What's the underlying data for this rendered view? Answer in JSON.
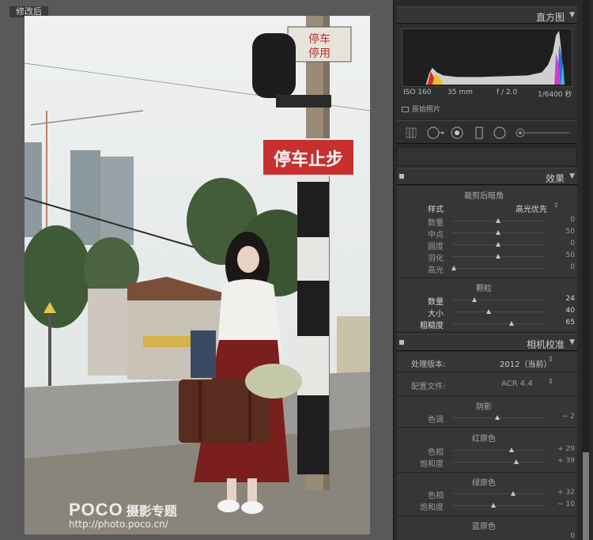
{
  "view": {
    "mode_label": "修改后",
    "watermark_brand": "POCO",
    "watermark_title": "摄影专题",
    "watermark_url": "http://photo.poco.cn/",
    "sign_text": "停车止步",
    "sign_top_line1": "停车",
    "sign_top_line2": "停用"
  },
  "histogram": {
    "title": "直方图",
    "iso": "ISO 160",
    "focal": "35 mm",
    "aperture": "f / 2.0",
    "shutter": "1/6400 秒",
    "original_label": "原始照片"
  },
  "effects": {
    "title": "效果",
    "vignette_heading": "裁剪后暗角",
    "style_label": "样式",
    "style_value": "高光优先",
    "sliders": [
      {
        "label": "数量",
        "value": "0",
        "pos": 0.5
      },
      {
        "label": "中点",
        "value": "50",
        "pos": 0.5
      },
      {
        "label": "圆度",
        "value": "0",
        "pos": 0.5
      },
      {
        "label": "羽化",
        "value": "50",
        "pos": 0.5
      },
      {
        "label": "高光",
        "value": "0",
        "pos": 0.02
      }
    ],
    "grain_heading": "颗粒",
    "grain": [
      {
        "label": "数量",
        "value": "24",
        "pos": 0.24
      },
      {
        "label": "大小",
        "value": "40",
        "pos": 0.4
      },
      {
        "label": "粗糙度",
        "value": "65",
        "pos": 0.65
      }
    ]
  },
  "camera": {
    "title": "相机校准",
    "process_label": "处理版本:",
    "process_value": "2012（当前）",
    "profile_label": "配置文件:",
    "profile_value": "ACR 4.4",
    "shadow_heading": "阴影",
    "shadow_tint": {
      "label": "色调",
      "value": "− 2",
      "pos": 0.49
    },
    "red_heading": "红原色",
    "red": [
      {
        "label": "色相",
        "value": "+ 29",
        "pos": 0.645
      },
      {
        "label": "饱和度",
        "value": "+ 39",
        "pos": 0.695
      }
    ],
    "green_heading": "绿原色",
    "green": [
      {
        "label": "色相",
        "value": "+ 32",
        "pos": 0.66
      },
      {
        "label": "饱和度",
        "value": "− 10",
        "pos": 0.45
      }
    ],
    "blue_heading": "蓝原色",
    "blue_hue_value": "0"
  },
  "colors": {
    "panel_bg": "#2a2a2a",
    "photo_bg": "#595959",
    "sign_red": "#c8302e",
    "skirt_red": "#7a1e1e"
  }
}
